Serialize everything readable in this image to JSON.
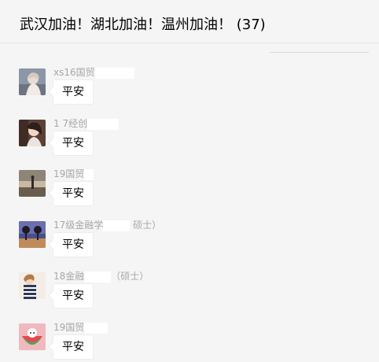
{
  "chat": {
    "title": "武汉加油！湖北加油！温州加油！ (37)"
  },
  "messages": [
    {
      "sender_prefix": "xs16国贸",
      "sender_suffix": "",
      "text": "平安",
      "avatar_icon": "woman-photo-avatar-icon"
    },
    {
      "sender_prefix": "1 7经创",
      "sender_suffix": "",
      "text": "平安",
      "avatar_icon": "girl-photo-avatar-icon"
    },
    {
      "sender_prefix": "19国贸",
      "sender_suffix": "",
      "text": "平安",
      "avatar_icon": "scenery-avatar-icon"
    },
    {
      "sender_prefix": "17级金融学",
      "sender_suffix": " 硕士）",
      "text": "平安",
      "avatar_icon": "trees-sunset-avatar-icon"
    },
    {
      "sender_prefix": "18金融",
      "sender_suffix": "（硕士）",
      "text": "平安",
      "avatar_icon": "girl-striped-avatar-icon"
    },
    {
      "sender_prefix": "19国贸",
      "sender_suffix": "",
      "text": "平安",
      "avatar_icon": "watermelon-avatar-icon"
    }
  ]
}
